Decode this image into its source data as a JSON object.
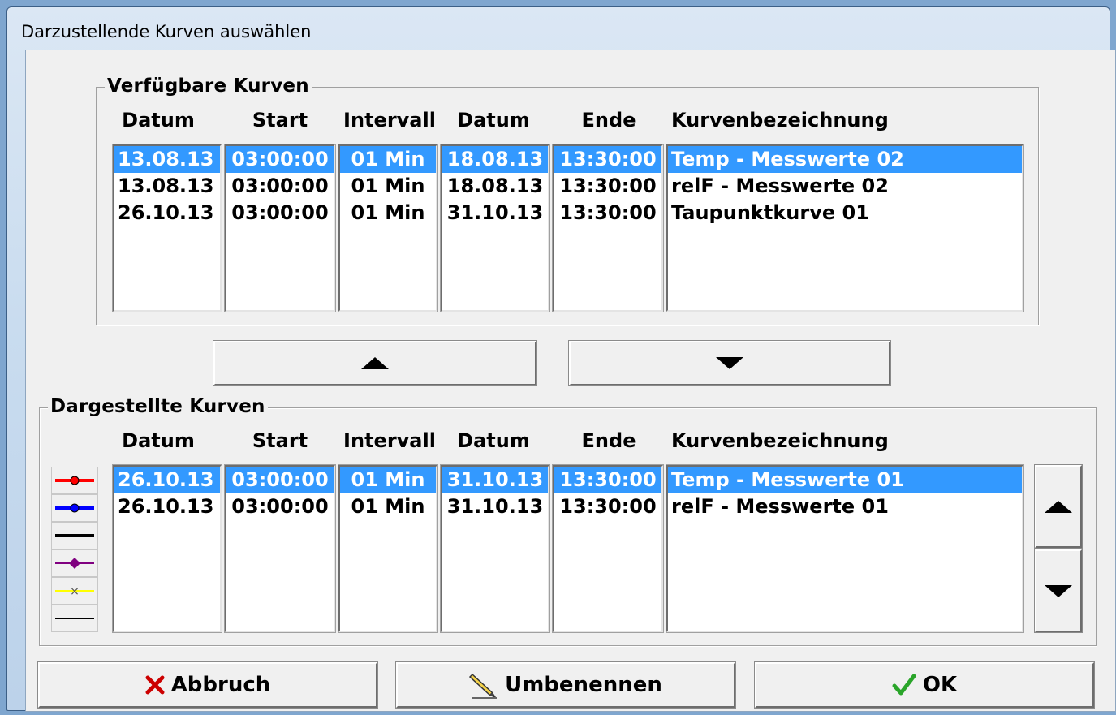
{
  "window": {
    "title": "Darzustellende Kurven auswählen"
  },
  "available": {
    "title": "Verfügbare Kurven",
    "headers": [
      "Datum",
      "Start",
      "Intervall",
      "Datum",
      "Ende",
      "Kurvenbezeichnung"
    ],
    "rows": [
      {
        "d1": "13.08.13",
        "start": "03:00:00",
        "intervall": "01 Min",
        "d2": "18.08.13",
        "ende": "13:30:00",
        "name": "Temp - Messwerte 02",
        "selected": true
      },
      {
        "d1": "13.08.13",
        "start": "03:00:00",
        "intervall": "01 Min",
        "d2": "18.08.13",
        "ende": "13:30:00",
        "name": "relF - Messwerte 02",
        "selected": false
      },
      {
        "d1": "26.10.13",
        "start": "03:00:00",
        "intervall": "01 Min",
        "d2": "31.10.13",
        "ende": "13:30:00",
        "name": "Taupunktkurve 01",
        "selected": false
      }
    ]
  },
  "displayed": {
    "title": "Dargestellte Kurven",
    "headers": [
      "Datum",
      "Start",
      "Intervall",
      "Datum",
      "Ende",
      "Kurvenbezeichnung"
    ],
    "rows": [
      {
        "d1": "26.10.13",
        "start": "03:00:00",
        "intervall": "01 Min",
        "d2": "31.10.13",
        "ende": "13:30:00",
        "name": "Temp - Messwerte 01",
        "selected": true
      },
      {
        "d1": "26.10.13",
        "start": "03:00:00",
        "intervall": "01 Min",
        "d2": "31.10.13",
        "ende": "13:30:00",
        "name": "relF - Messwerte 01",
        "selected": false
      }
    ],
    "legend": [
      {
        "color": "#ff0000",
        "marker": "circle"
      },
      {
        "color": "#0000ff",
        "marker": "circle"
      },
      {
        "color": "#000000",
        "marker": "none"
      },
      {
        "color": "#800080",
        "marker": "diamond"
      },
      {
        "color": "#ffff00",
        "marker": "x"
      },
      {
        "color": "#000000",
        "marker": "thin"
      }
    ]
  },
  "buttons": {
    "cancel": "Abbruch",
    "rename": "Umbenennen",
    "ok": "OK"
  },
  "colors": {
    "selection": "#3399ff",
    "cancel_icon": "#cc0000",
    "ok_icon": "#2aa52a"
  }
}
